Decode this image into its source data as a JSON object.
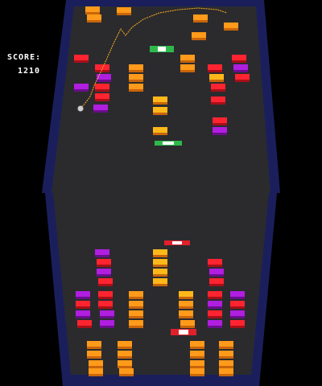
{
  "hud": {
    "score_label": "SCORE:",
    "score_value": "1210"
  },
  "colors": {
    "background": "#000000",
    "frame_outer": "#1a1f5c",
    "frame_inner": "#2b3596",
    "floor": "#2a2a2c",
    "brick_orange": "#ff9a1a",
    "brick_orange_dark": "#c9650a",
    "brick_red": "#ff2430",
    "brick_red_dark": "#a80f18",
    "brick_purple": "#b01ee0",
    "brick_purple_dark": "#6a0d8c",
    "brick_yellow": "#ffb81a",
    "paddle_green": "#2fb84a",
    "paddle_red": "#e0202a",
    "trajectory": "#ffb020",
    "ball": "#cfcfcf"
  },
  "entities": {
    "paddles": [
      {
        "name": "top-paddle-1",
        "color": "paddle_green"
      },
      {
        "name": "top-paddle-2",
        "color": "paddle_green"
      },
      {
        "name": "bottom-paddle-1",
        "color": "paddle_red"
      },
      {
        "name": "bottom-paddle-2",
        "color": "paddle_red"
      }
    ],
    "ball": {
      "name": "ball"
    }
  }
}
